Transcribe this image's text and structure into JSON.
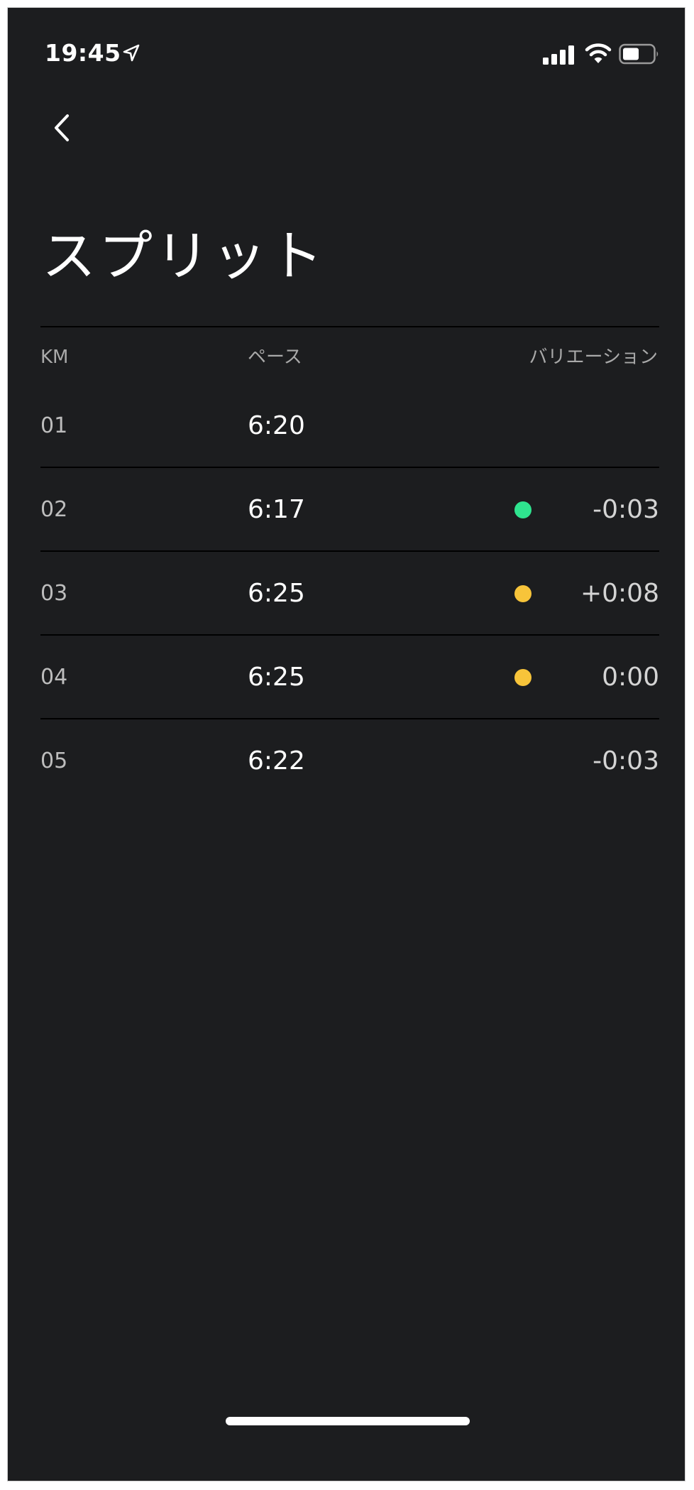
{
  "status_bar": {
    "time": "19:45",
    "location_icon": "location-arrow-icon",
    "signal_icon": "cellular-signal-icon",
    "wifi_icon": "wifi-icon",
    "battery_icon": "battery-icon"
  },
  "nav": {
    "back_icon": "chevron-left-icon"
  },
  "page": {
    "title": "スプリット"
  },
  "table": {
    "headers": {
      "km": "KM",
      "pace": "ペース",
      "variation": "バリエーション"
    },
    "rows": [
      {
        "km": "01",
        "pace": "6:20",
        "variation": "",
        "indicator": "none"
      },
      {
        "km": "02",
        "pace": "6:17",
        "variation": "-0:03",
        "indicator": "green"
      },
      {
        "km": "03",
        "pace": "6:25",
        "variation": "+0:08",
        "indicator": "yellow"
      },
      {
        "km": "04",
        "pace": "6:25",
        "variation": "0:00",
        "indicator": "yellow"
      },
      {
        "km": "05",
        "pace": "6:22",
        "variation": "-0:03",
        "indicator": "none"
      }
    ]
  },
  "colors": {
    "background": "#1c1d1f",
    "green": "#2fe48f",
    "yellow": "#f7c43a",
    "text_primary": "#ffffff",
    "text_secondary": "#a9a9a9"
  }
}
